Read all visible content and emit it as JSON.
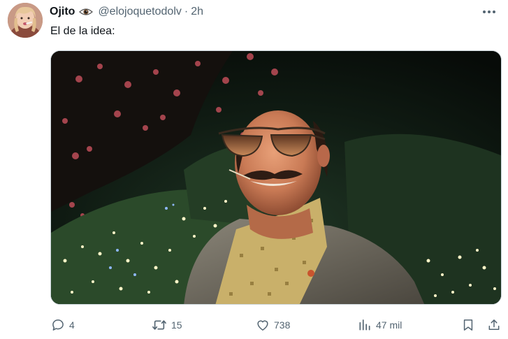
{
  "tweet": {
    "display_name": "Ojito",
    "handle": "@elojoquetodolv",
    "separator": "·",
    "timestamp": "2h",
    "text": "El de la idea:",
    "avatar_icon": "user-avatar-photo",
    "badge_icon": "eye-emoji-icon",
    "more_icon": "more-options-icon",
    "media_description_icon": "photo-man-sunglasses"
  },
  "actions": {
    "reply": {
      "icon": "reply-icon",
      "count": "4"
    },
    "retweet": {
      "icon": "retweet-icon",
      "count": "15"
    },
    "like": {
      "icon": "heart-icon",
      "count": "738"
    },
    "views": {
      "icon": "views-chart-icon",
      "count": "47 mil"
    },
    "bookmark": {
      "icon": "bookmark-icon"
    },
    "share": {
      "icon": "share-icon"
    }
  },
  "colors": {
    "text_primary": "#0f1419",
    "text_secondary": "#536471",
    "border": "#cfd9de",
    "background": "#ffffff"
  }
}
